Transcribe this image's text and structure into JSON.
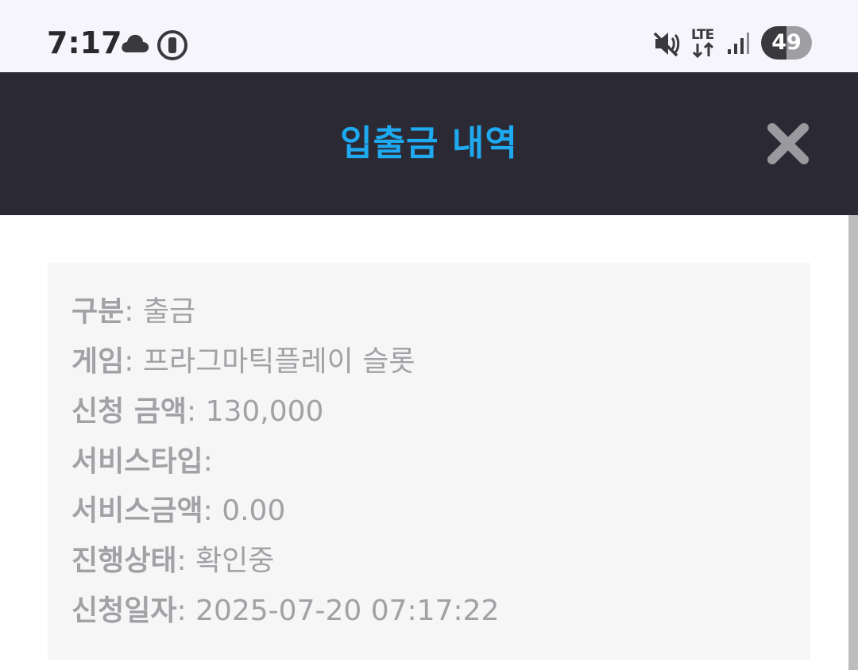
{
  "status_bar": {
    "time": "7:17",
    "icons": [
      "cloud-icon",
      "alarm-icon",
      "mute-icon",
      "lte-icon",
      "signal-icon"
    ],
    "lte_label": "LTE",
    "battery": "49"
  },
  "header": {
    "title": "입출금 내역",
    "title_color": "#1ea9f0",
    "background": "#2b2a34",
    "close_icon": "close-icon"
  },
  "details": [
    {
      "label": "구분",
      "value": "출금"
    },
    {
      "label": "게임",
      "value": "프라그마틱플레이 슬롯"
    },
    {
      "label": "신청 금액",
      "value": "130,000"
    },
    {
      "label": "서비스타입",
      "value": ""
    },
    {
      "label": "서비스금액",
      "value": "0.00"
    },
    {
      "label": "진행상태",
      "value": "확인중"
    },
    {
      "label": "신청일자",
      "value": "2025-07-20 07:17:22"
    }
  ]
}
